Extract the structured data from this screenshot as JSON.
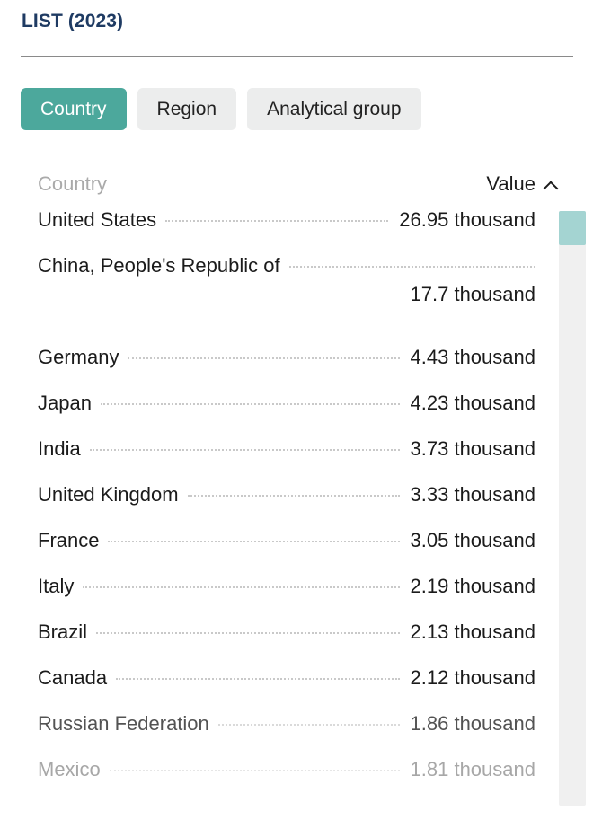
{
  "header": {
    "title": "LIST (2023)"
  },
  "tabs": [
    {
      "label": "Country",
      "active": true
    },
    {
      "label": "Region",
      "active": false
    },
    {
      "label": "Analytical group",
      "active": false
    }
  ],
  "table": {
    "columns": {
      "country_label": "Country",
      "value_label": "Value",
      "sort_icon": "chevron-up-icon",
      "sort_direction": "descending"
    },
    "unit": "thousand",
    "rows": [
      {
        "country": "United States",
        "value": "26.95 thousand",
        "number": 26.95,
        "wrapped": false,
        "fade": 0
      },
      {
        "country": "China, People's Republic of",
        "value": "17.7 thousand",
        "number": 17.7,
        "wrapped": true,
        "fade": 0
      },
      {
        "country": "Germany",
        "value": "4.43 thousand",
        "number": 4.43,
        "wrapped": false,
        "fade": 0
      },
      {
        "country": "Japan",
        "value": "4.23 thousand",
        "number": 4.23,
        "wrapped": false,
        "fade": 0
      },
      {
        "country": "India",
        "value": "3.73 thousand",
        "number": 3.73,
        "wrapped": false,
        "fade": 0
      },
      {
        "country": "United Kingdom",
        "value": "3.33 thousand",
        "number": 3.33,
        "wrapped": false,
        "fade": 0
      },
      {
        "country": "France",
        "value": "3.05 thousand",
        "number": 3.05,
        "wrapped": false,
        "fade": 0
      },
      {
        "country": "Italy",
        "value": "2.19 thousand",
        "number": 2.19,
        "wrapped": false,
        "fade": 0
      },
      {
        "country": "Brazil",
        "value": "2.13 thousand",
        "number": 2.13,
        "wrapped": false,
        "fade": 0
      },
      {
        "country": "Canada",
        "value": "2.12 thousand",
        "number": 2.12,
        "wrapped": false,
        "fade": 0
      },
      {
        "country": "Russian Federation",
        "value": "1.86 thousand",
        "number": 1.86,
        "wrapped": false,
        "fade": 1
      },
      {
        "country": "Mexico",
        "value": "1.81 thousand",
        "number": 1.81,
        "wrapped": false,
        "fade": 2
      }
    ]
  },
  "scrollbar": {
    "name": "vertical-scrollbar",
    "thumb_position": "top"
  },
  "colors": {
    "title": "#1f3b63",
    "accent_teal": "#4ca89c",
    "scrollbar_thumb": "#a4d4d2",
    "tab_inactive_bg": "#eceded"
  },
  "chart_data": {
    "type": "table",
    "title": "LIST (2023)",
    "xlabel": "Country",
    "ylabel": "Value",
    "unit": "thousand",
    "categories": [
      "United States",
      "China, People's Republic of",
      "Germany",
      "Japan",
      "India",
      "United Kingdom",
      "France",
      "Italy",
      "Brazil",
      "Canada",
      "Russian Federation",
      "Mexico"
    ],
    "values": [
      26.95,
      17.7,
      4.43,
      4.23,
      3.73,
      3.33,
      3.05,
      2.19,
      2.13,
      2.12,
      1.86,
      1.81
    ],
    "sorted": "descending",
    "grid": false,
    "legend": "none"
  }
}
